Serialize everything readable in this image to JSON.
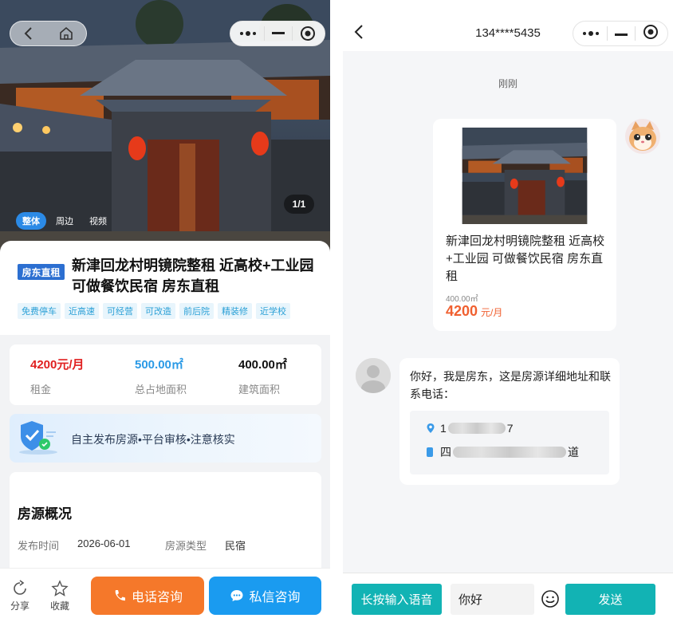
{
  "listing": {
    "media_counter": "1/1",
    "media_tabs": [
      "整体",
      "周边",
      "视频"
    ],
    "badge": "房东直租",
    "title": "新津回龙村明镜院整租 近高校+工业园 可做餐饮民宿 房东直租",
    "tags": [
      "免费停车",
      "近高速",
      "可经营",
      "可改造",
      "前后院",
      "精装修",
      "近学校"
    ],
    "stats": [
      {
        "value": "4200元/月",
        "label": "租金",
        "color": "#e02020"
      },
      {
        "value": "500.00㎡",
        "label": "总占地面积",
        "color": "#2b9ae6"
      },
      {
        "value": "400.00㎡",
        "label": "建筑面积",
        "color": "#111111"
      }
    ],
    "notice": "自主发布房源•平台审核•注意核实",
    "overview": {
      "title": "房源概况",
      "publish_label": "发布时间",
      "publish_value": "2026-06-01",
      "type_label": "房源类型",
      "type_value": "民宿"
    },
    "bottom": {
      "share": "分享",
      "favorite": "收藏",
      "phone_button": "电话咨询",
      "message_button": "私信咨询"
    }
  },
  "chat": {
    "title": "134****5435",
    "time_label": "刚刚",
    "sent_card": {
      "title": "新津回龙村明镜院整租 近高校+工业园 可做餐饮民宿 房东直租",
      "area": "400.00㎡",
      "price": "4200",
      "price_unit": "元/月"
    },
    "reply": {
      "text": "你好，我是房东，这是房源详细地址和联系电话：",
      "phone_prefix": "1",
      "phone_suffix": "7",
      "address_prefix": "四",
      "address_suffix": "道"
    },
    "input": {
      "voice_button": "长按输入语音",
      "value": "你好",
      "send_button": "发送"
    }
  },
  "colors": {
    "accent_orange": "#f5782a",
    "accent_blue": "#1a9bf0",
    "chat_teal": "#12b3b4",
    "price_red": "#f06030"
  }
}
